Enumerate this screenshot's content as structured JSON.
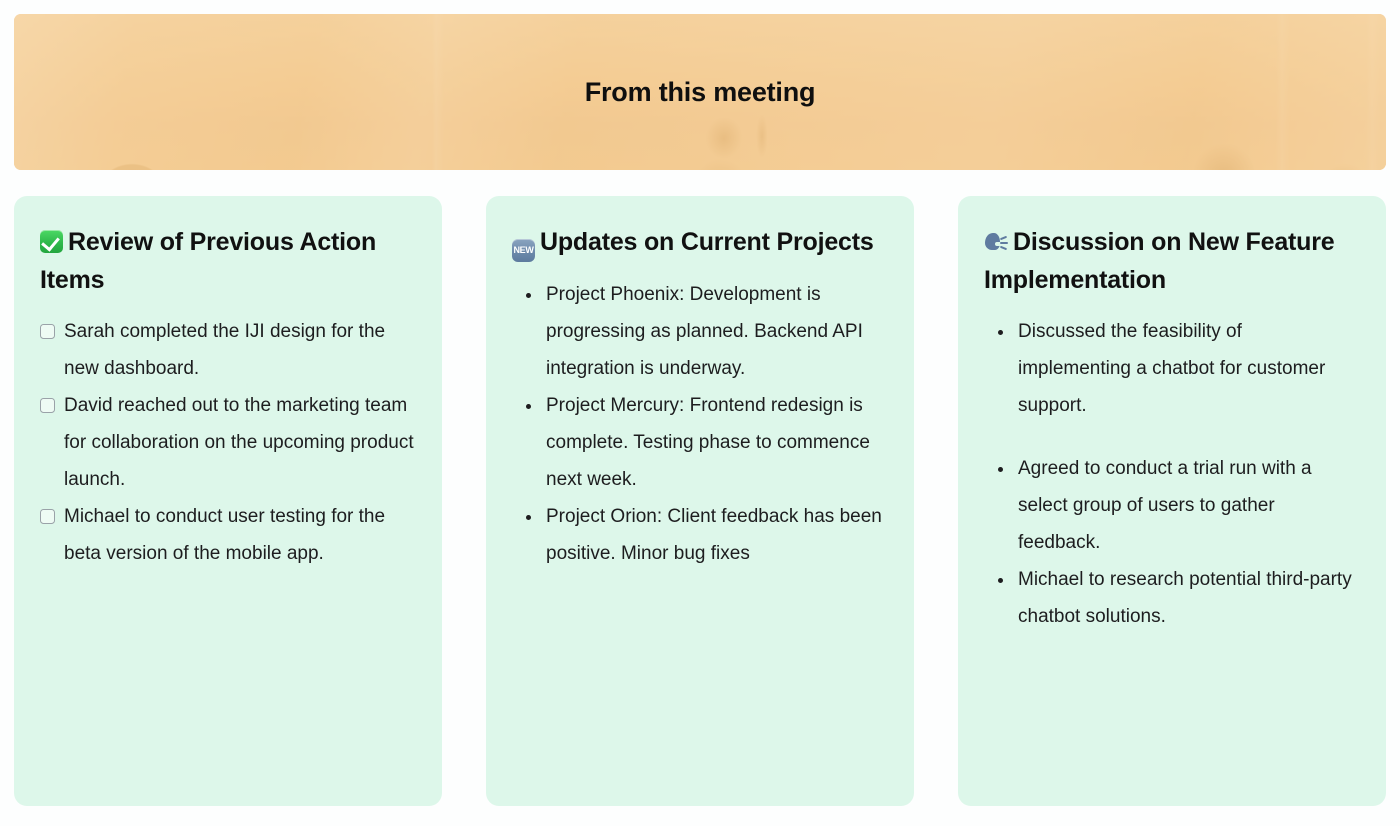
{
  "banner": {
    "title": "From this meeting",
    "background_tint": "#f3ca8f",
    "image_description": "meeting-room-audience-photo"
  },
  "theme": {
    "page_background": "#fdfefe",
    "card_background": "#ddf7ea",
    "text_color": "#1d1d1f",
    "checkbox_border": "#9aa2a8",
    "emoji_green": "#30b94c",
    "emoji_blue_gray": "#6d8aab"
  },
  "cards": [
    {
      "icon": "white-check-mark-emoji",
      "icon_label": "✅",
      "title": "Review of Previous Action Items",
      "list_type": "checklist",
      "items": [
        {
          "checked": false,
          "text": "Sarah completed the IJI design for the new dashboard."
        },
        {
          "checked": false,
          "text": "David reached out to the marketing team for collaboration on the upcoming product launch."
        },
        {
          "checked": false,
          "text": "Michael to conduct user testing for the beta version of the mobile app."
        }
      ]
    },
    {
      "icon": "new-button-emoji",
      "icon_label": "NEW",
      "title": "Updates on Current Projects",
      "list_type": "bullets",
      "items": [
        {
          "text": "Project Phoenix: Development is progressing as planned. Backend API integration is underway."
        },
        {
          "text": "Project Mercury: Frontend redesign is complete. Testing phase to commence next week."
        },
        {
          "text": "Project Orion: Client feedback has been positive. Minor bug fixes"
        }
      ]
    },
    {
      "icon": "speaking-head-emoji",
      "icon_label": "🗣",
      "title": "Discussion on New Feature Implementation",
      "list_type": "bullets",
      "items": [
        {
          "text": "Discussed the feasibility of implementing a chatbot for customer support."
        },
        {
          "text": "Agreed to conduct a trial run with a select group of users to gather feedback.",
          "extra_spacing": true
        },
        {
          "text": "Michael to research potential third-party chatbot solutions."
        }
      ]
    }
  ]
}
